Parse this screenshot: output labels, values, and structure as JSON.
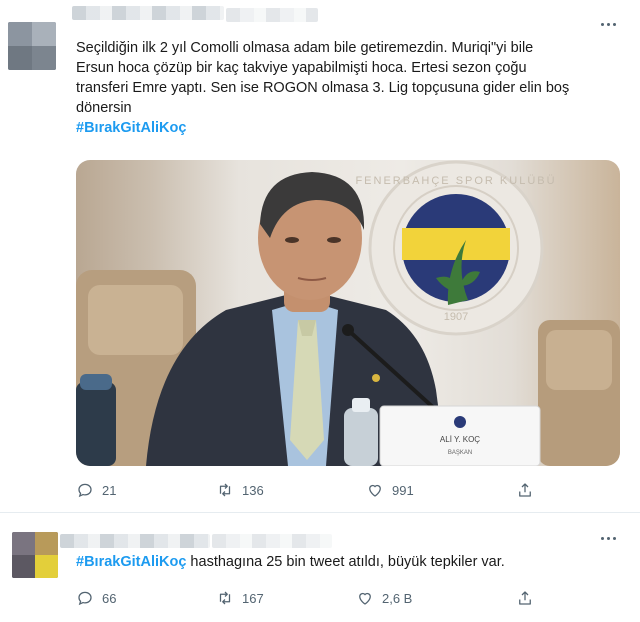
{
  "colors": {
    "link": "#1d9bf0",
    "icon": "#536471",
    "divider": "#e6ecf0"
  },
  "tweets": [
    {
      "text_lines": [
        "Seçildiğin ilk 2 yıl Comolli olmasa adam bile getiremezdin. Muriqi\"yi bile",
        "Ersun hoca çözüp bir kaç takviye yapabilmişti hoca. Ertesi sezon çoğu",
        "transferi Emre yaptı. Sen ise ROGON olmasa 3. Lig topçusuna gider elin boş",
        "dönersin"
      ],
      "hashtag": "#BırakGitAliKoç",
      "photo": {
        "nameplate_name": "ALİ Y. KOÇ",
        "nameplate_title": "BAŞKAN",
        "logo_text_top": "FENERBAHÇE SPOR KULÜBÜ",
        "logo_year": "1907"
      },
      "actions": {
        "replies": "21",
        "retweets": "136",
        "likes": "991"
      }
    },
    {
      "hashtag": "#BırakGitAliKoç",
      "text_rest": " hasthagına 25 bin tweet atıldı, büyük tepkiler var.",
      "actions": {
        "replies": "66",
        "retweets": "167",
        "likes": "2,6 B"
      }
    }
  ]
}
